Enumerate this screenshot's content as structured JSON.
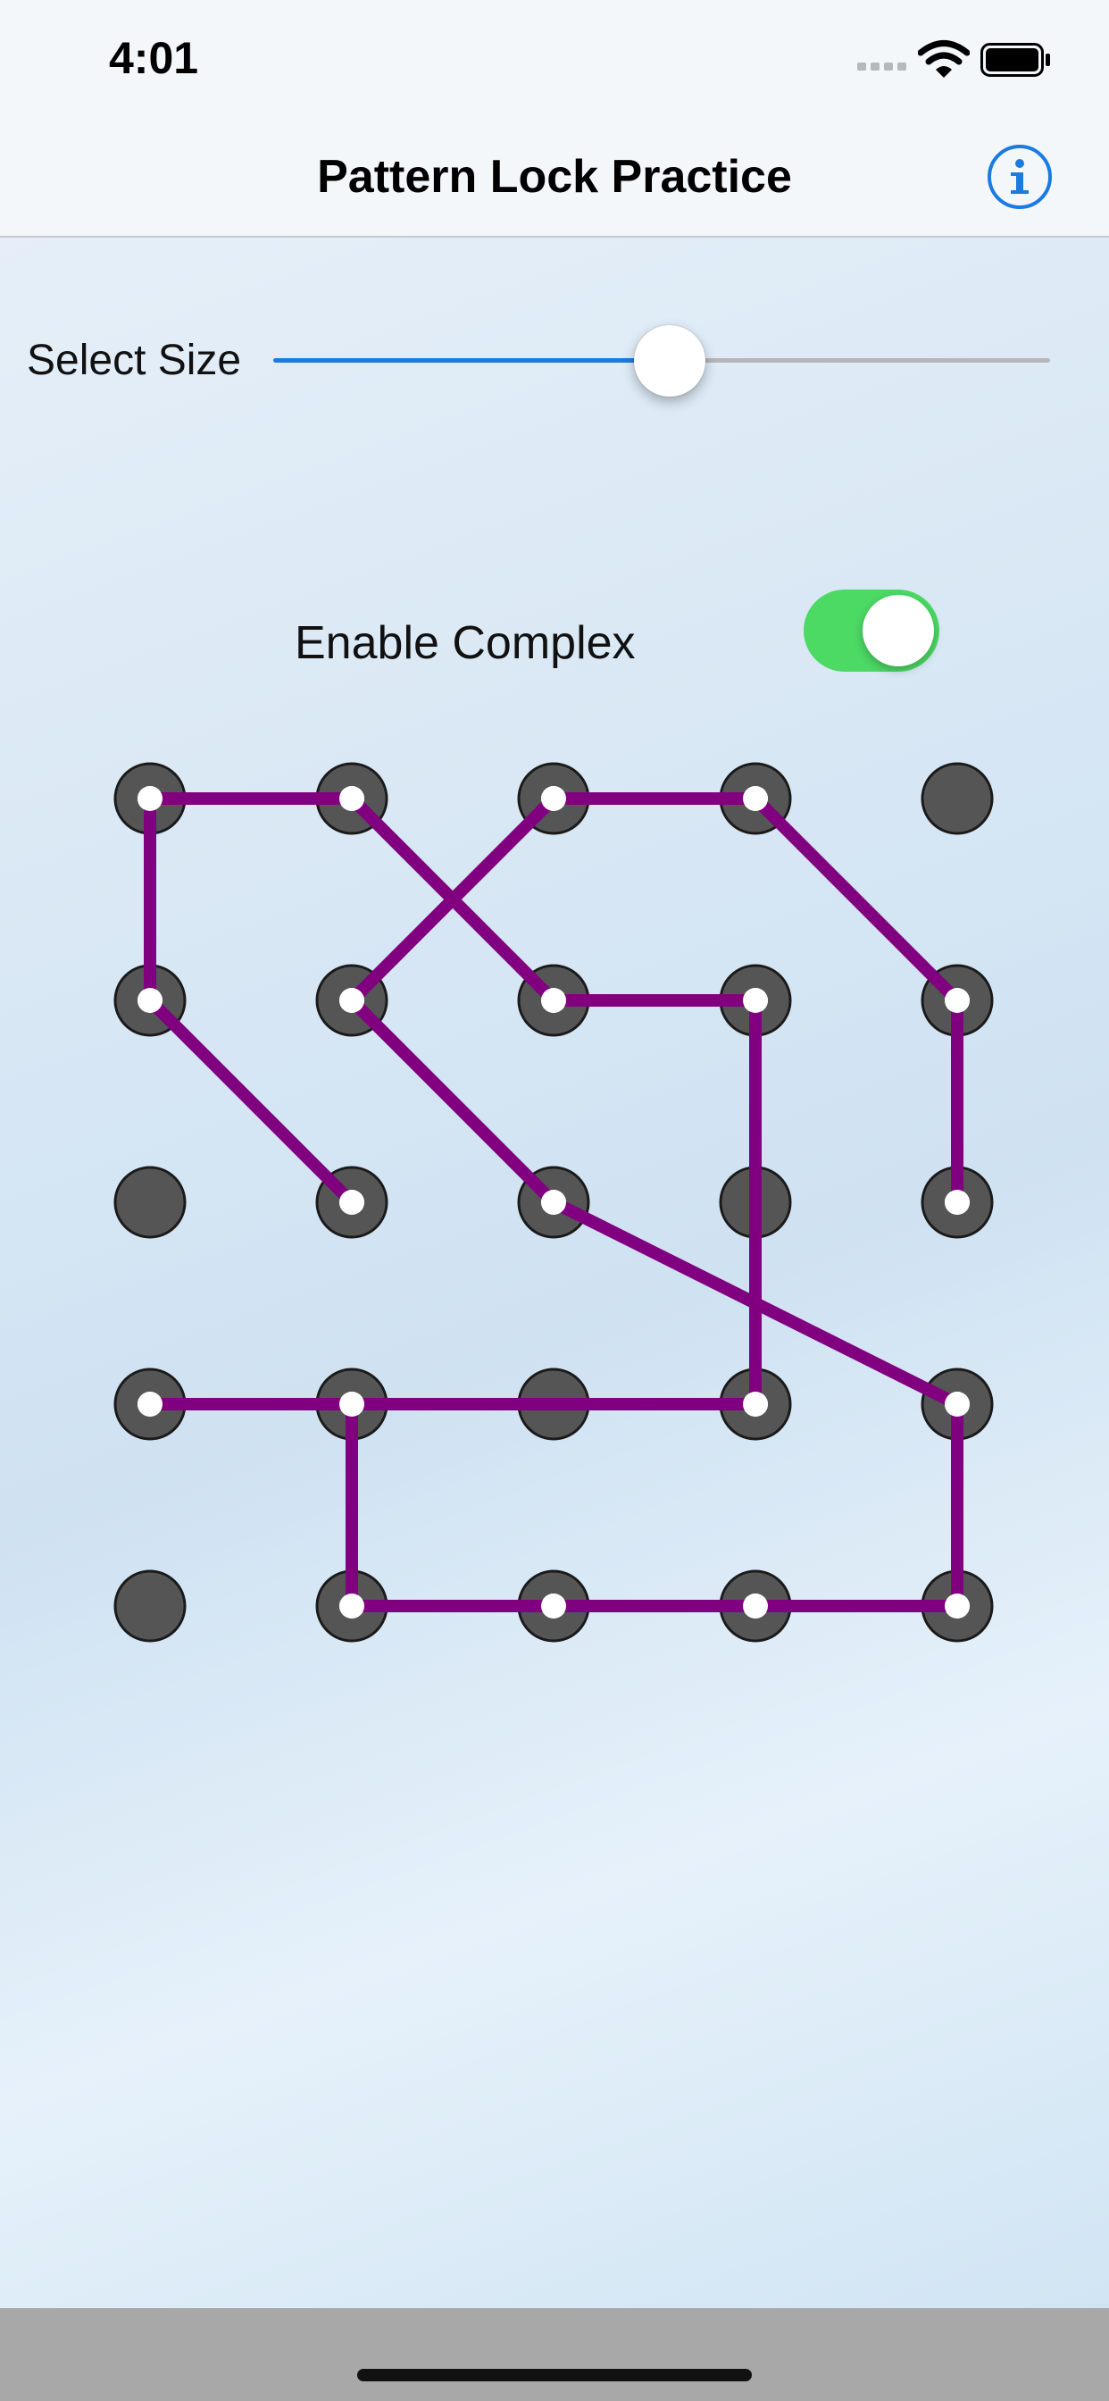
{
  "status_bar": {
    "time": "4:01"
  },
  "nav": {
    "title": "Pattern Lock Practice",
    "info_icon": "info-circle-icon"
  },
  "size_control": {
    "label": "Select Size",
    "value_fraction": 0.51
  },
  "complex_control": {
    "label": "Enable Complex",
    "enabled": true
  },
  "pattern": {
    "rows": 5,
    "cols": 5,
    "sequence": [
      [
        2,
        1
      ],
      [
        1,
        0
      ],
      [
        0,
        0
      ],
      [
        0,
        1
      ],
      [
        1,
        2
      ],
      [
        1,
        3
      ],
      [
        3,
        3
      ],
      [
        3,
        0
      ],
      [
        3,
        1
      ],
      [
        4,
        1
      ],
      [
        4,
        2
      ],
      [
        4,
        3
      ],
      [
        4,
        4
      ],
      [
        3,
        4
      ],
      [
        2,
        2
      ],
      [
        1,
        1
      ],
      [
        0,
        2
      ],
      [
        0,
        3
      ],
      [
        1,
        4
      ],
      [
        2,
        4
      ]
    ],
    "colors": {
      "line": "#800080",
      "dot": "#555555",
      "dot_outline": "#1a1a1a",
      "selected_center": "#ffffff"
    }
  },
  "colors": {
    "accent": "#1a7be0",
    "toggle_on": "#4cd964"
  }
}
